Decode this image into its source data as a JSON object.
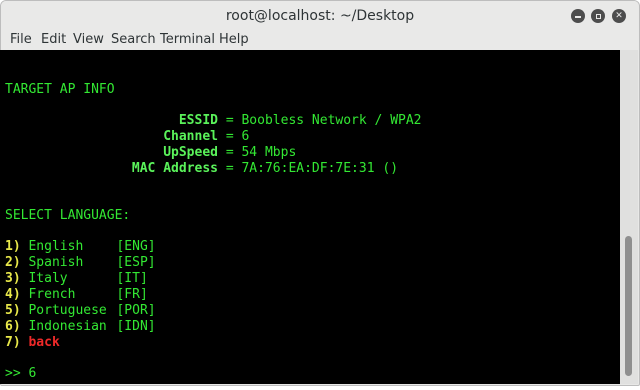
{
  "window": {
    "title": "root@localhost: ~/Desktop"
  },
  "menu": [
    "File",
    "Edit",
    "View",
    "Search",
    "Terminal",
    "Help"
  ],
  "terminal": {
    "section1": "TARGET AP INFO",
    "ap_info": [
      {
        "label": "ESSID",
        "value": "Boobless Network / WPA2"
      },
      {
        "label": "Channel",
        "value": "6"
      },
      {
        "label": "UpSpeed",
        "value": "54 Mbps"
      },
      {
        "label": "MAC Address",
        "value": "7A:76:EA:DF:7E:31 ()"
      }
    ],
    "section2": "SELECT LANGUAGE:",
    "options": [
      {
        "num": "1)",
        "name": "English",
        "code": "[ENG]"
      },
      {
        "num": "2)",
        "name": "Spanish",
        "code": "[ESP]"
      },
      {
        "num": "3)",
        "name": "Italy",
        "code": "[IT]"
      },
      {
        "num": "4)",
        "name": "French",
        "code": "[FR]"
      },
      {
        "num": "5)",
        "name": "Portuguese",
        "code": "[POR]"
      },
      {
        "num": "6)",
        "name": "Indonesian",
        "code": "[IDN]"
      }
    ],
    "back_option": {
      "num": "7)",
      "name": "back"
    },
    "prompt": ">>",
    "input": "6"
  },
  "colors": {
    "terminal_bg": "#000000",
    "text_green": "#33e833",
    "label_green": "#5af25a",
    "number_yellow": "#e8e84a",
    "back_red": "#ef2929"
  }
}
